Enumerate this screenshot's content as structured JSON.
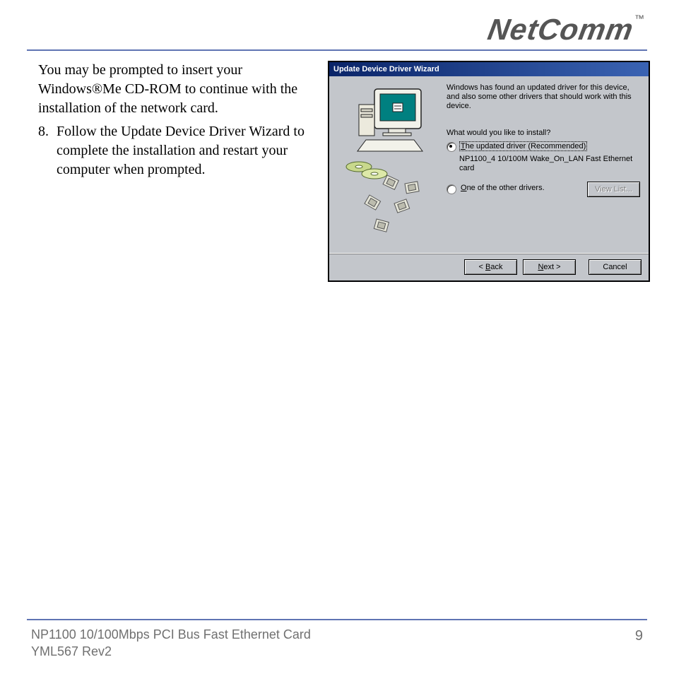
{
  "header": {
    "brand": "NetComm",
    "tm": "™"
  },
  "body": {
    "intro_para": "You may be prompted to insert your Windows®Me CD-ROM to continue with the installation of the network card.",
    "step": {
      "number": "8.",
      "text": "Follow the Update Device Driver Wizard to complete the installation and restart your computer when prompted."
    }
  },
  "dialog": {
    "title": "Update Device Driver Wizard",
    "intro": "Windows has found an updated driver for this device, and also some other drivers that should work with this device.",
    "question": "What would you like to install?",
    "option1": {
      "label_pre": "T",
      "label_rest": "he updated driver (Recommended)",
      "sub": "NP1100_4 10/100M Wake_On_LAN Fast Ethernet card"
    },
    "option2": {
      "label_pre": "O",
      "label_rest": "ne of the other drivers.",
      "view_list": "View List..."
    },
    "buttons": {
      "back_pre": "< ",
      "back_u": "B",
      "back_rest": "ack",
      "next_pre": "",
      "next_u": "N",
      "next_rest": "ext >",
      "cancel": "Cancel"
    }
  },
  "footer": {
    "line1": "NP1100 10/100Mbps PCI Bus Fast Ethernet Card",
    "line2": "YML567 Rev2",
    "page": "9"
  }
}
